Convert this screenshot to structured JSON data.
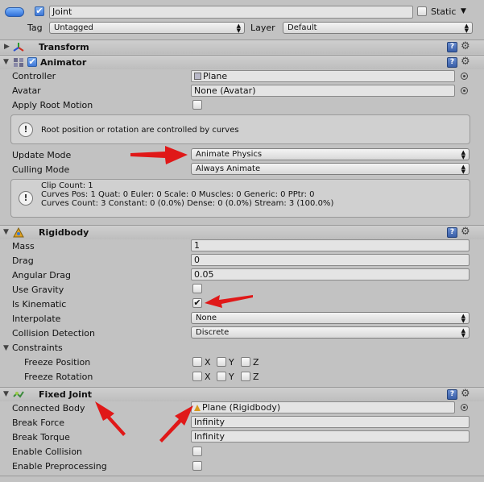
{
  "header": {
    "object_name": "Joint",
    "active": true,
    "static_label": "Static",
    "tag_label": "Tag",
    "tag_value": "Untagged",
    "layer_label": "Layer",
    "layer_value": "Default"
  },
  "transform": {
    "title": "Transform"
  },
  "animator": {
    "title": "Animator",
    "enabled": true,
    "controller_label": "Controller",
    "controller_value": "Plane",
    "avatar_label": "Avatar",
    "avatar_value": "None (Avatar)",
    "apply_root_motion_label": "Apply Root Motion",
    "apply_root_motion": false,
    "root_info": "Root position or rotation are controlled by curves",
    "update_mode_label": "Update Mode",
    "update_mode_value": "Animate Physics",
    "culling_mode_label": "Culling Mode",
    "culling_mode_value": "Always Animate",
    "clip_line1": "Clip Count: 1",
    "clip_line2": "Curves Pos: 1 Quat: 0 Euler: 0 Scale: 0 Muscles: 0 Generic: 0 PPtr: 0",
    "clip_line3": "Curves Count: 3 Constant: 0 (0.0%) Dense: 0 (0.0%) Stream: 3 (100.0%)"
  },
  "rigidbody": {
    "title": "Rigidbody",
    "mass_label": "Mass",
    "mass_value": "1",
    "drag_label": "Drag",
    "drag_value": "0",
    "angular_drag_label": "Angular Drag",
    "angular_drag_value": "0.05",
    "use_gravity_label": "Use Gravity",
    "use_gravity": false,
    "is_kinematic_label": "Is Kinematic",
    "is_kinematic": true,
    "interpolate_label": "Interpolate",
    "interpolate_value": "None",
    "collision_detection_label": "Collision Detection",
    "collision_detection_value": "Discrete",
    "constraints_label": "Constraints",
    "freeze_position_label": "Freeze Position",
    "freeze_rotation_label": "Freeze Rotation",
    "axis_x": "X",
    "axis_y": "Y",
    "axis_z": "Z"
  },
  "fixed_joint": {
    "title": "Fixed Joint",
    "connected_body_label": "Connected Body",
    "connected_body_value": "Plane (Rigidbody)",
    "break_force_label": "Break Force",
    "break_force_value": "Infinity",
    "break_torque_label": "Break Torque",
    "break_torque_value": "Infinity",
    "enable_collision_label": "Enable Collision",
    "enable_collision": false,
    "enable_preprocessing_label": "Enable Preprocessing",
    "enable_preprocessing": false
  },
  "icons": {
    "check": "✔",
    "dropdown": "▲▼",
    "info": "!",
    "help": "?",
    "gear": "⚙",
    "fold_open": "▼",
    "fold_closed": "▶",
    "static_menu": "▼"
  },
  "colors": {
    "annotation_arrow": "#e01818",
    "panel_bg": "#c2c2c2",
    "accent_blue": "#3f78d8"
  }
}
